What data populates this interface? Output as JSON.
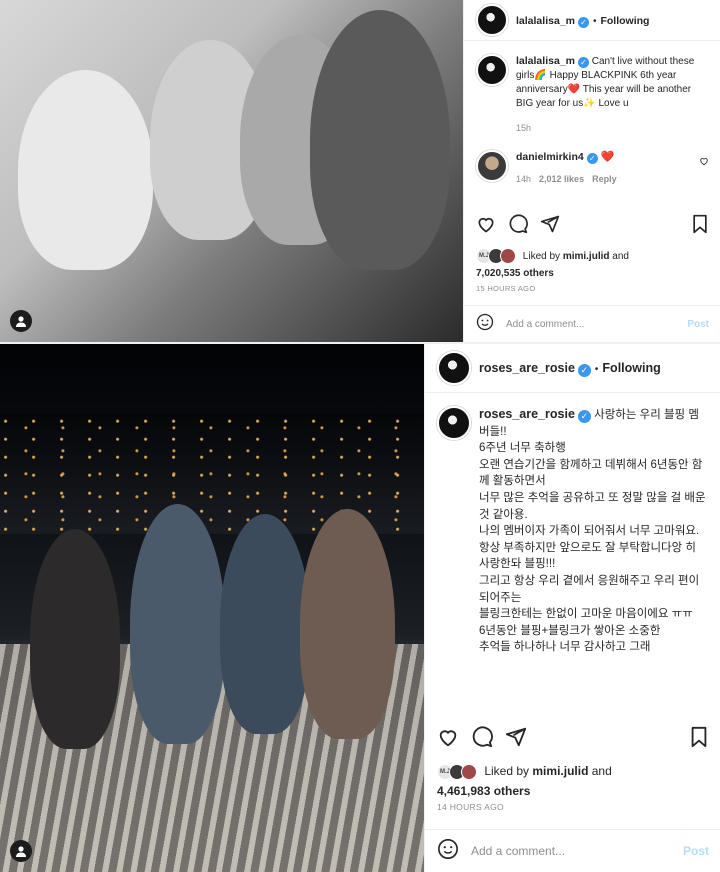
{
  "post1": {
    "username": "lalalalisa_m",
    "following": "Following",
    "caption": "Can't live without these girls🌈 Happy BLACKPINK 6th year anniversary❤️ This year will be another BIG year for us✨ Love u",
    "caption_time": "15h",
    "comment": {
      "username": "danielmirkin4",
      "text": "❤️",
      "time": "14h",
      "likes": "2,012 likes",
      "reply": "Reply"
    },
    "liked_by_prefix": "Liked by",
    "liked_by_user": "mimi.julid",
    "liked_by_and": "and",
    "others": "7,020,535 others",
    "time_ago": "15 HOURS AGO",
    "add_comment": "Add a comment...",
    "post_label": "Post"
  },
  "post2": {
    "username": "roses_are_rosie",
    "following": "Following",
    "caption": "사랑하는 우리 블핑 멤버들!!\n6주년 너무 축하행\n오랜 연습기간을 함께하고 데뷔해서 6년동안 함께 활동하면서\n너무 많은 추억을 공유하고 또 정말 많을 걸 배운 것 같아용.\n나의 멤버이자 가족이 되어줘서 너무 고마워요.\n항상 부족하지만 앞으로도 잘 부탁합니다앙 히\n사랑한돠 블핑!!!\n그리고 항상 우리 곁에서 응원해주고 우리 편이 되어주는\n블링크한테는 한없이 고마운 마음이에요 ㅠㅠ\n6년동안 블핑+블링크가 쌓아온 소중한\n추억들 하나하나 너무 감사하고 그래",
    "liked_by_prefix": "Liked by",
    "liked_by_user": "mimi.julid",
    "liked_by_and": "and",
    "others": "4,461,983 others",
    "time_ago": "14 HOURS AGO",
    "add_comment": "Add a comment...",
    "post_label": "Post"
  },
  "mini_avatar_initials": "M.J",
  "colors": {
    "verified": "#3897f0",
    "heart": "#ed4956",
    "post_button": "#b2dffc",
    "muted": "#8e8e8e"
  }
}
